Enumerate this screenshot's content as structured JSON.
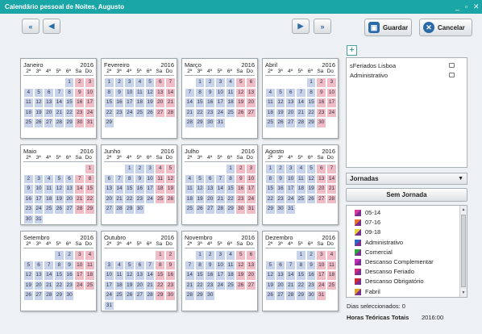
{
  "window": {
    "title": "Calendário pessoal de Noites, Augusto",
    "minimize": "_",
    "restore": "▫",
    "close": "✕"
  },
  "nav": {
    "first_icon": "double-left-arrow",
    "prev_icon": "left-arrow",
    "next_icon": "right-arrow",
    "last_icon": "double-right-arrow"
  },
  "actions": {
    "save_label": "Guardar",
    "cancel_label": "Cancelar"
  },
  "weekdays": [
    "2ª",
    "3ª",
    "4ª",
    "5ª",
    "6ª",
    "Sa",
    "Do"
  ],
  "months": [
    {
      "name": "Janeiro",
      "year": "2016",
      "offset": 4,
      "days": 31
    },
    {
      "name": "Fevereiro",
      "year": "2016",
      "offset": 0,
      "days": 29
    },
    {
      "name": "Março",
      "year": "2016",
      "offset": 1,
      "days": 31
    },
    {
      "name": "Abril",
      "year": "2016",
      "offset": 4,
      "days": 30
    },
    {
      "name": "Maio",
      "year": "2016",
      "offset": 6,
      "days": 31
    },
    {
      "name": "Junho",
      "year": "2016",
      "offset": 2,
      "days": 30
    },
    {
      "name": "Julho",
      "year": "2016",
      "offset": 4,
      "days": 31
    },
    {
      "name": "Agosto",
      "year": "2016",
      "offset": 0,
      "days": 31
    },
    {
      "name": "Setembro",
      "year": "2016",
      "offset": 3,
      "days": 30
    },
    {
      "name": "Outubro",
      "year": "2016",
      "offset": 5,
      "days": 31
    },
    {
      "name": "Novembro",
      "year": "2016",
      "offset": 1,
      "days": 30
    },
    {
      "name": "Dezembro",
      "year": "2016",
      "offset": 3,
      "days": 31
    }
  ],
  "calendars": [
    {
      "label": "sFeriados Lisboa"
    },
    {
      "label": "Administrativo"
    }
  ],
  "jornadas": {
    "label": "Jornadas",
    "no_shift_button": "Sem Jornada",
    "items": [
      {
        "label": "05-14",
        "color": "#d63aa0"
      },
      {
        "label": "07-16",
        "color": "#e8752a"
      },
      {
        "label": "09-18",
        "color": "#e6d23a"
      },
      {
        "label": "Administrativo",
        "color": "#2d66c4"
      },
      {
        "label": "Comercial",
        "color": "#2ea83a"
      },
      {
        "label": "Descanso Complementar",
        "color": "#c42dba"
      },
      {
        "label": "Descanso Feriado",
        "color": "#cc2a7a"
      },
      {
        "label": "Descanso Obrigatório",
        "color": "#d42a2a"
      },
      {
        "label": "Fabril",
        "color": "#e0a020"
      }
    ]
  },
  "summary": {
    "selected_days": "Dias seleccionados: 0",
    "total_hours_label": "Horas Teóricas Totais",
    "total_hours_value": "2016:00"
  }
}
